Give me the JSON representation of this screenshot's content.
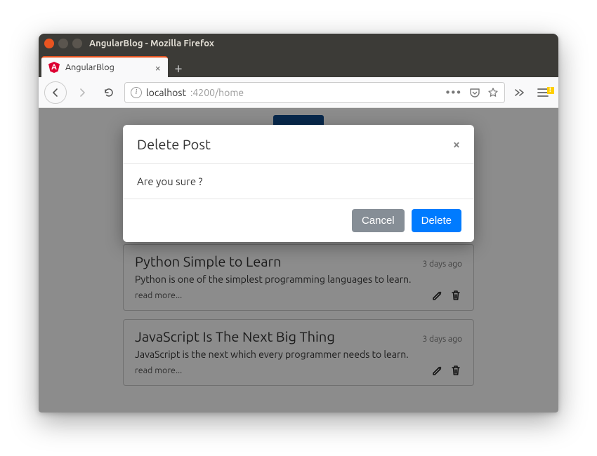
{
  "window": {
    "title": "AngularBlog - Mozilla Firefox"
  },
  "tab": {
    "label": "AngularBlog"
  },
  "url": {
    "host": "localhost",
    "path": ":4200/home"
  },
  "modal": {
    "title": "Delete Post",
    "body": "Are you sure ?",
    "cancel_label": "Cancel",
    "confirm_label": "Delete"
  },
  "posts": [
    {
      "title": "Python Simple to Learn",
      "desc": "Python is one of the simplest programming languages to learn.",
      "time": "3 days ago",
      "read_more": "read more..."
    },
    {
      "title": "JavaScript Is The Next Big Thing",
      "desc": "JavaScript is the next which every programmer needs to learn.",
      "time": "3 days ago",
      "read_more": "read more..."
    }
  ]
}
